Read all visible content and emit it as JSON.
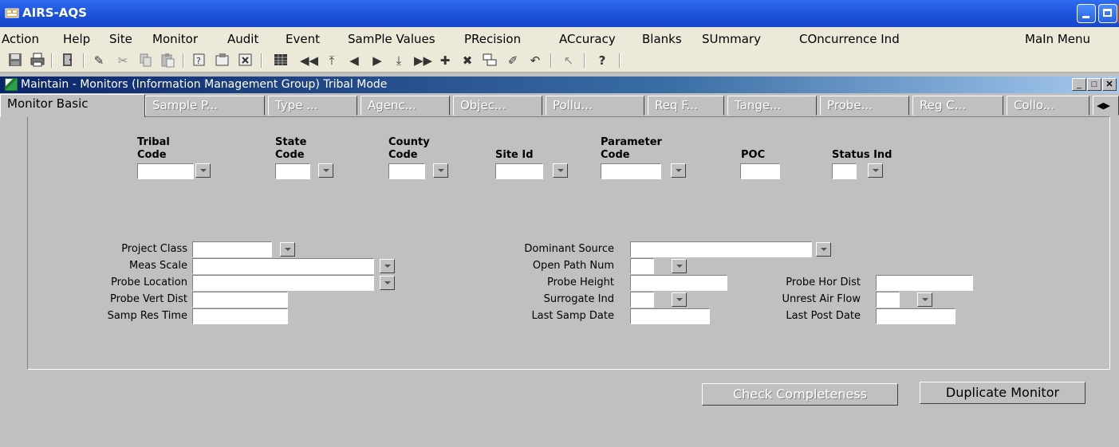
{
  "window": {
    "title": "AIRS-AQS"
  },
  "menu": [
    "Action",
    "Help",
    "Site",
    "Monitor",
    "Audit",
    "Event",
    "SamPle Values",
    "PRecision",
    "ACcuracy",
    "Blanks",
    "SUmmary",
    "COncurrence Ind",
    "MaIn Menu"
  ],
  "toolbar_icons": [
    "save-icon",
    "print-icon",
    "exit-icon",
    "edit-icon",
    "cut-icon",
    "copy-icon",
    "paste-icon",
    "query-icon",
    "execute-query-icon",
    "cancel-query-icon",
    "grid-icon",
    "first-record-icon",
    "previous-set-icon",
    "previous-record-icon",
    "next-record-icon",
    "next-set-icon",
    "last-record-icon",
    "insert-record-icon",
    "delete-record-icon",
    "duplicate-record-icon",
    "clear-icon",
    "undo-icon",
    "list-icon",
    "help-icon"
  ],
  "inner_window": {
    "title": "Maintain - Monitors (Information Management Group) Tribal Mode"
  },
  "tabs": [
    "Monitor Basic",
    "Sample P...",
    "Type ...",
    "Agenc...",
    "Objec...",
    "Pollu...",
    "Req F...",
    "Tange...",
    "Probe...",
    "Reg C...",
    "Collo..."
  ],
  "headers": {
    "tribal_code": [
      "Tribal",
      "Code"
    ],
    "state_code": [
      "State",
      "Code"
    ],
    "county_code": [
      "County",
      "Code"
    ],
    "site_id": "Site Id",
    "parameter_code": [
      "Parameter",
      "Code"
    ],
    "poc": "POC",
    "status_ind": "Status Ind"
  },
  "fields": {
    "project_class": "Project Class",
    "meas_scale": "Meas Scale",
    "probe_location": "Probe Location",
    "probe_vert_dist": "Probe Vert Dist",
    "samp_res_time": "Samp Res Time",
    "dominant_source": "Dominant Source",
    "open_path_num": "Open Path Num",
    "probe_height": "Probe Height",
    "surrogate_ind": "Surrogate Ind",
    "last_samp_date": "Last Samp Date",
    "probe_hor_dist": "Probe Hor Dist",
    "unrest_air_flow": "Unrest Air Flow",
    "last_post_date": "Last Post Date"
  },
  "buttons": {
    "check_completeness": "Check Completeness",
    "duplicate_monitor": "Duplicate Monitor"
  }
}
